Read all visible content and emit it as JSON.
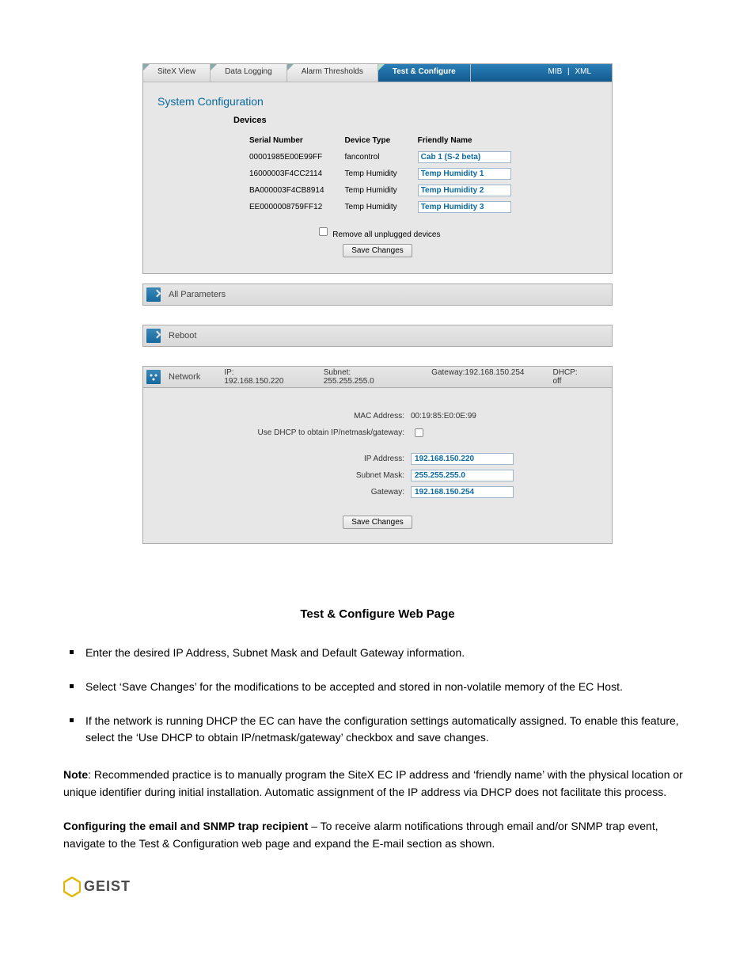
{
  "tabs": {
    "t0": "SiteX View",
    "t1": "Data Logging",
    "t2": "Alarm Thresholds",
    "t3": "Test & Configure"
  },
  "toplinks": {
    "mib": "MIB",
    "sep": "|",
    "xml": "XML"
  },
  "syscfg": {
    "title": "System Configuration",
    "devices_title": "Devices",
    "headers": {
      "serial": "Serial Number",
      "type": "Device Type",
      "friendly": "Friendly Name"
    },
    "rows": [
      {
        "serial": "00001985E00E99FF",
        "type": "fancontrol",
        "friendly": "Cab 1 (S-2 beta)"
      },
      {
        "serial": "16000003F4CC2114",
        "type": "Temp Humidity",
        "friendly": "Temp Humidity 1"
      },
      {
        "serial": "BA000003F4CB8914",
        "type": "Temp Humidity",
        "friendly": "Temp Humidity 2"
      },
      {
        "serial": "EE0000008759FF12",
        "type": "Temp Humidity",
        "friendly": "Temp Humidity 3"
      }
    ],
    "remove_label": "Remove all unplugged devices",
    "save_label": "Save Changes"
  },
  "exp": {
    "all_params": "All Parameters",
    "reboot": "Reboot",
    "network": "Network",
    "ip_label": "IP:",
    "ip_value": "192.168.150.220",
    "subnet_label": "Subnet:",
    "subnet_value": "255.255.255.0",
    "gw_label": "Gateway:",
    "gw_value": "192.168.150.254",
    "dhcp_label": "DHCP:",
    "dhcp_value": "off"
  },
  "netform": {
    "mac_label": "MAC Address:",
    "mac_value": "00:19:85:E0:0E:99",
    "dhcp_label": "Use DHCP to obtain IP/netmask/gateway:",
    "ip_label": "IP Address:",
    "ip_value": "192.168.150.220",
    "subnet_label": "Subnet Mask:",
    "subnet_value": "255.255.255.0",
    "gw_label": "Gateway:",
    "gw_value": "192.168.150.254",
    "save_label": "Save Changes"
  },
  "doc": {
    "title": "Test & Configure Web Page",
    "b1": "Enter the desired IP Address, Subnet Mask and Default Gateway information.",
    "b2": "Select ‘Save Changes’ for the modifications to be accepted and stored in non-volatile memory of the EC Host.",
    "b3": "If the network is running DHCP the EC can have the configuration settings automatically assigned.  To enable this feature, select the ‘Use DHCP to obtain IP/netmask/gateway’ checkbox and save changes.",
    "note_label": "Note",
    "note_body": ": Recommended practice is to manually program the SiteX EC IP address and ‘friendly name’ with the physical location or unique identifier during initial installation. Automatic assignment of the IP address via DHCP does not facilitate this process.",
    "cfg_label": "Configuring the email and SNMP trap recipient",
    "cfg_body": " – To receive alarm notifications through email and/or SNMP trap event, navigate to the Test & Configuration web page and expand the E-mail section as shown."
  },
  "logo": {
    "text": "GEIST"
  }
}
